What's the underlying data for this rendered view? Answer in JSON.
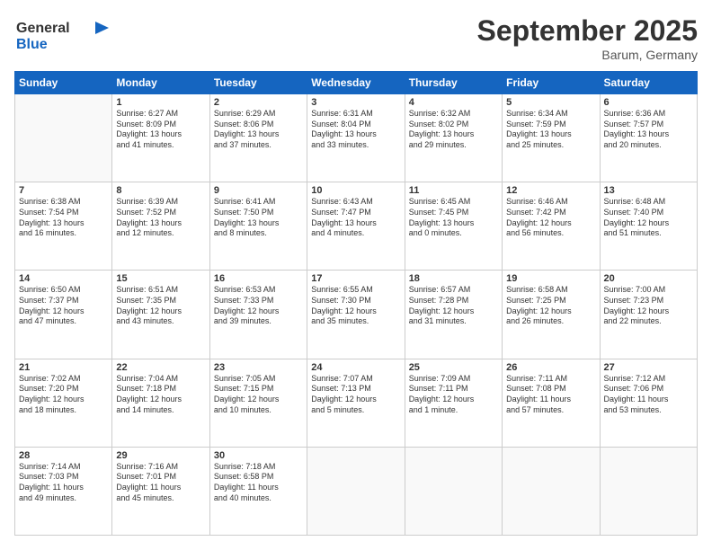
{
  "header": {
    "logo_line1": "General",
    "logo_line2": "Blue",
    "month": "September 2025",
    "location": "Barum, Germany"
  },
  "days_of_week": [
    "Sunday",
    "Monday",
    "Tuesday",
    "Wednesday",
    "Thursday",
    "Friday",
    "Saturday"
  ],
  "weeks": [
    [
      {
        "day": "",
        "info": ""
      },
      {
        "day": "1",
        "info": "Sunrise: 6:27 AM\nSunset: 8:09 PM\nDaylight: 13 hours\nand 41 minutes."
      },
      {
        "day": "2",
        "info": "Sunrise: 6:29 AM\nSunset: 8:06 PM\nDaylight: 13 hours\nand 37 minutes."
      },
      {
        "day": "3",
        "info": "Sunrise: 6:31 AM\nSunset: 8:04 PM\nDaylight: 13 hours\nand 33 minutes."
      },
      {
        "day": "4",
        "info": "Sunrise: 6:32 AM\nSunset: 8:02 PM\nDaylight: 13 hours\nand 29 minutes."
      },
      {
        "day": "5",
        "info": "Sunrise: 6:34 AM\nSunset: 7:59 PM\nDaylight: 13 hours\nand 25 minutes."
      },
      {
        "day": "6",
        "info": "Sunrise: 6:36 AM\nSunset: 7:57 PM\nDaylight: 13 hours\nand 20 minutes."
      }
    ],
    [
      {
        "day": "7",
        "info": "Sunrise: 6:38 AM\nSunset: 7:54 PM\nDaylight: 13 hours\nand 16 minutes."
      },
      {
        "day": "8",
        "info": "Sunrise: 6:39 AM\nSunset: 7:52 PM\nDaylight: 13 hours\nand 12 minutes."
      },
      {
        "day": "9",
        "info": "Sunrise: 6:41 AM\nSunset: 7:50 PM\nDaylight: 13 hours\nand 8 minutes."
      },
      {
        "day": "10",
        "info": "Sunrise: 6:43 AM\nSunset: 7:47 PM\nDaylight: 13 hours\nand 4 minutes."
      },
      {
        "day": "11",
        "info": "Sunrise: 6:45 AM\nSunset: 7:45 PM\nDaylight: 13 hours\nand 0 minutes."
      },
      {
        "day": "12",
        "info": "Sunrise: 6:46 AM\nSunset: 7:42 PM\nDaylight: 12 hours\nand 56 minutes."
      },
      {
        "day": "13",
        "info": "Sunrise: 6:48 AM\nSunset: 7:40 PM\nDaylight: 12 hours\nand 51 minutes."
      }
    ],
    [
      {
        "day": "14",
        "info": "Sunrise: 6:50 AM\nSunset: 7:37 PM\nDaylight: 12 hours\nand 47 minutes."
      },
      {
        "day": "15",
        "info": "Sunrise: 6:51 AM\nSunset: 7:35 PM\nDaylight: 12 hours\nand 43 minutes."
      },
      {
        "day": "16",
        "info": "Sunrise: 6:53 AM\nSunset: 7:33 PM\nDaylight: 12 hours\nand 39 minutes."
      },
      {
        "day": "17",
        "info": "Sunrise: 6:55 AM\nSunset: 7:30 PM\nDaylight: 12 hours\nand 35 minutes."
      },
      {
        "day": "18",
        "info": "Sunrise: 6:57 AM\nSunset: 7:28 PM\nDaylight: 12 hours\nand 31 minutes."
      },
      {
        "day": "19",
        "info": "Sunrise: 6:58 AM\nSunset: 7:25 PM\nDaylight: 12 hours\nand 26 minutes."
      },
      {
        "day": "20",
        "info": "Sunrise: 7:00 AM\nSunset: 7:23 PM\nDaylight: 12 hours\nand 22 minutes."
      }
    ],
    [
      {
        "day": "21",
        "info": "Sunrise: 7:02 AM\nSunset: 7:20 PM\nDaylight: 12 hours\nand 18 minutes."
      },
      {
        "day": "22",
        "info": "Sunrise: 7:04 AM\nSunset: 7:18 PM\nDaylight: 12 hours\nand 14 minutes."
      },
      {
        "day": "23",
        "info": "Sunrise: 7:05 AM\nSunset: 7:15 PM\nDaylight: 12 hours\nand 10 minutes."
      },
      {
        "day": "24",
        "info": "Sunrise: 7:07 AM\nSunset: 7:13 PM\nDaylight: 12 hours\nand 5 minutes."
      },
      {
        "day": "25",
        "info": "Sunrise: 7:09 AM\nSunset: 7:11 PM\nDaylight: 12 hours\nand 1 minute."
      },
      {
        "day": "26",
        "info": "Sunrise: 7:11 AM\nSunset: 7:08 PM\nDaylight: 11 hours\nand 57 minutes."
      },
      {
        "day": "27",
        "info": "Sunrise: 7:12 AM\nSunset: 7:06 PM\nDaylight: 11 hours\nand 53 minutes."
      }
    ],
    [
      {
        "day": "28",
        "info": "Sunrise: 7:14 AM\nSunset: 7:03 PM\nDaylight: 11 hours\nand 49 minutes."
      },
      {
        "day": "29",
        "info": "Sunrise: 7:16 AM\nSunset: 7:01 PM\nDaylight: 11 hours\nand 45 minutes."
      },
      {
        "day": "30",
        "info": "Sunrise: 7:18 AM\nSunset: 6:58 PM\nDaylight: 11 hours\nand 40 minutes."
      },
      {
        "day": "",
        "info": ""
      },
      {
        "day": "",
        "info": ""
      },
      {
        "day": "",
        "info": ""
      },
      {
        "day": "",
        "info": ""
      }
    ]
  ]
}
